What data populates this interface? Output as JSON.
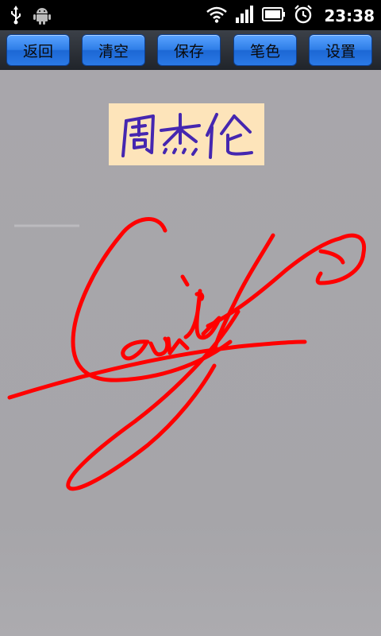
{
  "status_bar": {
    "time": "23:38",
    "icons": [
      "usb-icon",
      "android-icon",
      "wifi-icon",
      "signal-icon",
      "battery-icon",
      "alarm-icon"
    ]
  },
  "toolbar": {
    "back_label": "返回",
    "clear_label": "清空",
    "save_label": "保存",
    "pen_color_label": "笔色",
    "settings_label": "设置"
  },
  "canvas": {
    "name_text": "周杰伦",
    "name_box_color": "#fde4ba",
    "name_ink_color": "#4527b0",
    "signature_color": "#ff0000",
    "background_color": "#a7a6aa"
  }
}
